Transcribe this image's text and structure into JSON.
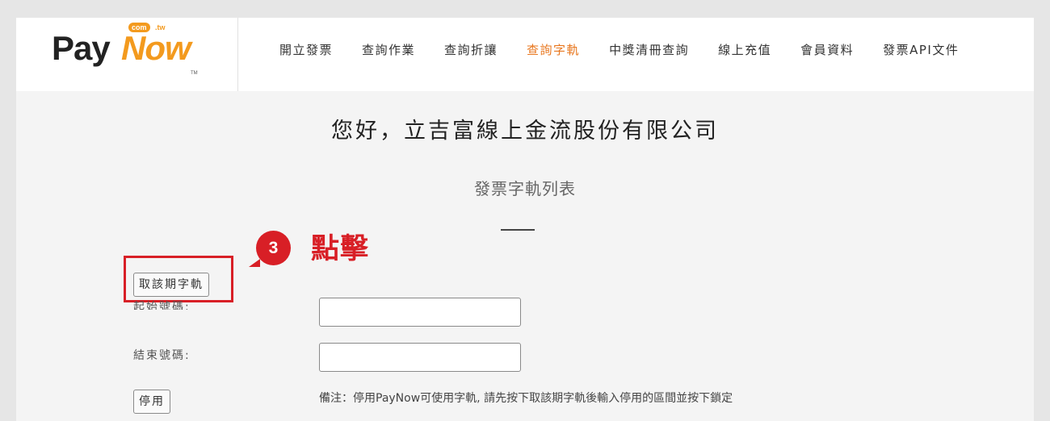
{
  "brand": {
    "logo_pay": "Pay",
    "logo_now": "Now",
    "logo_com": "com",
    "logo_tw": ".tw",
    "logo_tm": "TM"
  },
  "nav": {
    "items": [
      {
        "label": "開立發票",
        "active": false
      },
      {
        "label": "查詢作業",
        "active": false
      },
      {
        "label": "查詢折讓",
        "active": false
      },
      {
        "label": "查詢字軌",
        "active": true
      },
      {
        "label": "中獎清冊查詢",
        "active": false
      },
      {
        "label": "線上充值",
        "active": false
      },
      {
        "label": "會員資料",
        "active": false
      },
      {
        "label": "發票API文件",
        "active": false
      }
    ]
  },
  "main": {
    "greeting": "您好，立吉富線上金流股份有限公司",
    "subtitle": "發票字軌列表",
    "get_track_button": "取該期字軌",
    "start_label": "起始號碼:",
    "end_label": "結束號碼:",
    "start_value": "",
    "end_value": "",
    "disable_button": "停用",
    "note": "備注：停用PayNow可使用字軌, 請先按下取該期字軌後輸入停用的區間並按下鎖定"
  },
  "annotation": {
    "step_number": "3",
    "step_text": "點擊"
  },
  "colors": {
    "accent": "#e8771f",
    "annotation_red": "#d81f26",
    "logo_orange": "#f39a1e"
  }
}
